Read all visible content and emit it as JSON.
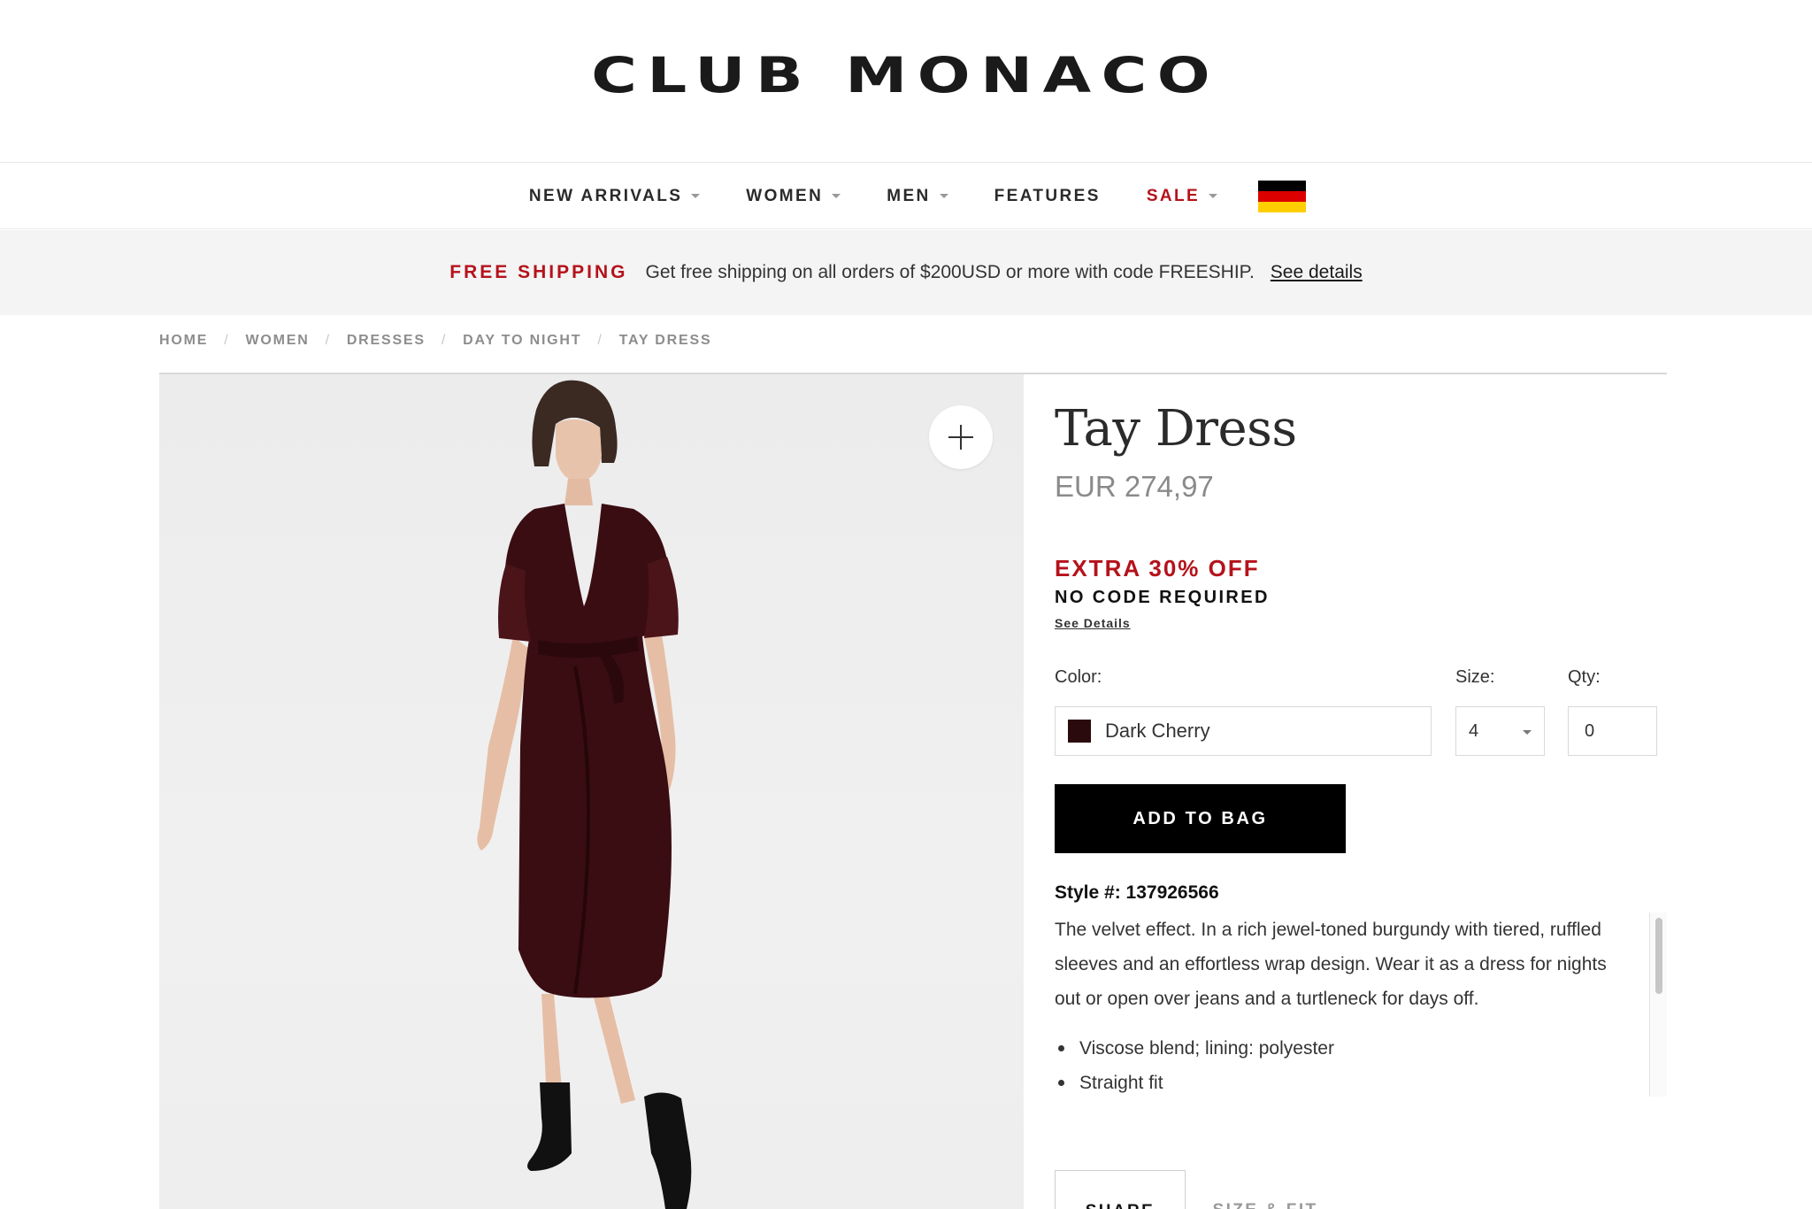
{
  "brand": {
    "logo": "CLUB MONACO"
  },
  "nav": {
    "items": [
      {
        "label": "NEW ARRIVALS"
      },
      {
        "label": "WOMEN"
      },
      {
        "label": "MEN"
      },
      {
        "label": "FEATURES"
      },
      {
        "label": "SALE"
      }
    ],
    "flag_icon": "germany-flag-icon",
    "flag_colors": [
      "#000000",
      "#dd0000",
      "#ffce00"
    ]
  },
  "promo": {
    "title": "FREE SHIPPING",
    "text": "Get free shipping on all orders of $200USD or more with code FREESHIP.",
    "link": "See details"
  },
  "breadcrumb": [
    "HOME",
    "WOMEN",
    "DRESSES",
    "DAY TO NIGHT",
    "TAY DRESS"
  ],
  "product": {
    "title": "Tay Dress",
    "price": "EUR 274,97",
    "offer": "EXTRA 30% OFF",
    "offer_sub": "NO CODE REQUIRED",
    "offer_link": "See Details",
    "color_label": "Color:",
    "size_label": "Size:",
    "qty_label": "Qty:",
    "color_value": "Dark Cherry",
    "color_swatch": "#2b0a0e",
    "size_value": "4",
    "qty_value": "0",
    "add_to_bag": "ADD TO BAG",
    "style_number": "Style #: 137926566",
    "description": "The velvet effect. In a rich jewel-toned burgundy with tiered, ruffled sleeves and an effortless wrap design. Wear it as a dress for nights out or open over jeans and a turtleneck for days off.",
    "bullets": [
      "Viscose blend; lining: polyester",
      "Straight fit"
    ]
  },
  "tabs": [
    {
      "label": "SHARE"
    },
    {
      "label": "SIZE & FIT"
    }
  ],
  "colors": {
    "accent_red": "#b5121b",
    "button_black": "#000000",
    "dress": "#3a0d12"
  }
}
